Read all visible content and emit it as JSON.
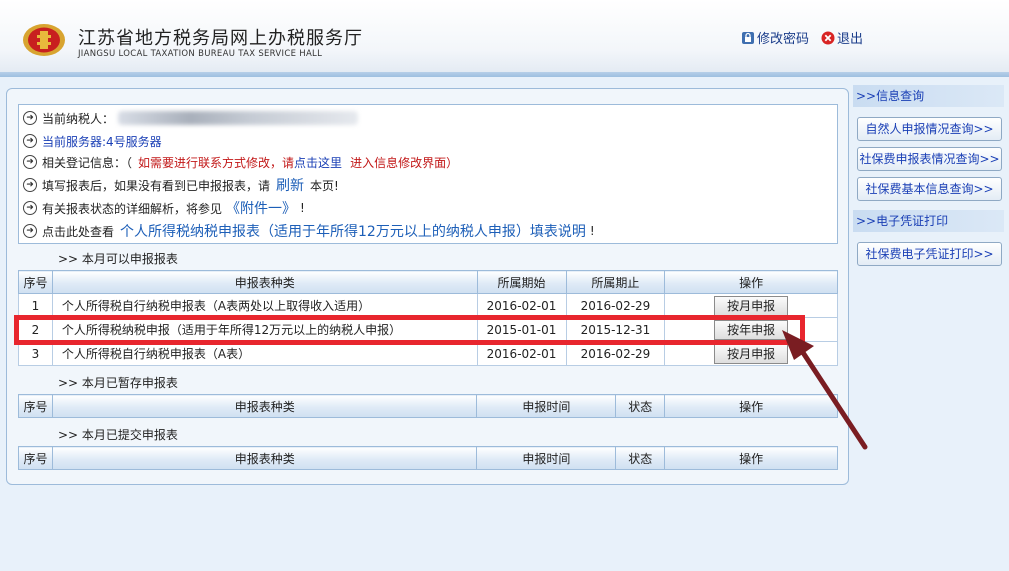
{
  "header": {
    "title_cn": "江苏省地方税务局网上办税服务厅",
    "title_en": "JIANGSU LOCAL TAXATION BUREAU TAX SERVICE HALL",
    "change_password": "修改密码",
    "logout": "退出"
  },
  "info": {
    "taxpayer_label": "当前纳税人：",
    "server_text": "当前服务器:4号服务器",
    "reg_label": "相关登记信息：（",
    "reg_red1": "如需要进行联系方式修改，",
    "reg_please": "请",
    "reg_click": "点击这里",
    "reg_red2": "进入信息修改界面）",
    "refresh_pre": "填写报表后，如果没有看到已申报报表，请",
    "refresh_link": "刷新",
    "refresh_post": "本页!",
    "status_pre": "有关报表状态的详细解析，将参见",
    "status_link": "《附件一》",
    "status_post": "!",
    "view_pre": "点击此处查看",
    "view_link": "个人所得税纳税申报表（适用于年所得12万元以上的纳税人申报）填表说明",
    "view_post": "!"
  },
  "sections": {
    "available": ">>  本月可以申报报表",
    "saved": ">>  本月已暂存申报表",
    "submitted": ">>  本月已提交申报表"
  },
  "table_available": {
    "headers": [
      "序号",
      "申报表种类",
      "所属期始",
      "所属期止",
      "操作"
    ],
    "rows": [
      {
        "no": "1",
        "type": "个人所得税自行纳税申报表（A表两处以上取得收入适用）",
        "start": "2016-02-01",
        "end": "2016-02-29",
        "action": "按月申报"
      },
      {
        "no": "2",
        "type": "个人所得税纳税申报（适用于年所得12万元以上的纳税人申报）",
        "start": "2015-01-01",
        "end": "2015-12-31",
        "action": "按年申报"
      },
      {
        "no": "3",
        "type": "个人所得税自行纳税申报表（A表）",
        "start": "2016-02-01",
        "end": "2016-02-29",
        "action": "按月申报"
      }
    ]
  },
  "table_saved": {
    "headers": [
      "序号",
      "申报表种类",
      "申报时间",
      "状态",
      "操作"
    ]
  },
  "table_submitted": {
    "headers": [
      "序号",
      "申报表种类",
      "申报时间",
      "状态",
      "操作"
    ]
  },
  "sidebar": {
    "info_query_head": ">>信息查询",
    "items": [
      "自然人申报情况查询>>",
      "社保费申报表情况查询>>",
      "社保费基本信息查询>>"
    ],
    "print_head": ">>电子凭证打印",
    "print_item": "社保费电子凭证打印>>"
  },
  "colors": {
    "highlight": "#e8262e",
    "arrow": "#7a1d22",
    "link": "#1a3fb5",
    "warning_text": "#c21818"
  },
  "icons": [
    "tax-emblem-icon",
    "lock-icon",
    "close-icon",
    "circle-arrow-icon"
  ]
}
